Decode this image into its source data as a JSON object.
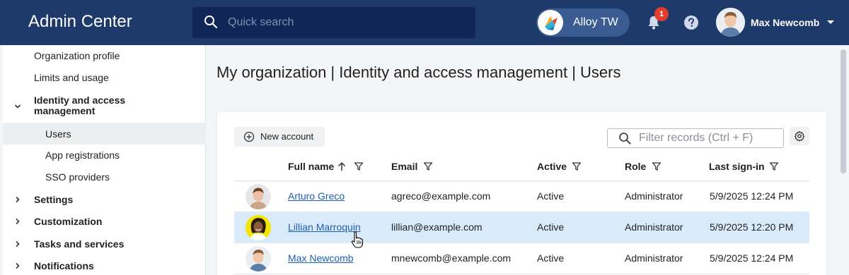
{
  "header": {
    "app_title": "Admin Center",
    "search_placeholder": "Quick search",
    "tenant_name": "Alloy TW",
    "notification_count": "1",
    "user_name": "Max Newcomb",
    "colors": {
      "bar": "#1d3a6b",
      "search": "#0f2656",
      "badge": "#e53b2d"
    }
  },
  "sidebar": {
    "items": [
      {
        "label": "Organization profile"
      },
      {
        "label": "Limits and usage"
      },
      {
        "label": "Identity and access management"
      },
      {
        "label": "Users"
      },
      {
        "label": "App registrations"
      },
      {
        "label": "SSO providers"
      },
      {
        "label": "Settings"
      },
      {
        "label": "Customization"
      },
      {
        "label": "Tasks and services"
      },
      {
        "label": "Notifications"
      }
    ]
  },
  "main": {
    "title": "My organization | Identity and access management | Users",
    "new_account_label": "New account",
    "filter_placeholder": "Filter records (Ctrl + F)",
    "columns": [
      "Full name",
      "Email",
      "Active",
      "Role",
      "Last sign-in"
    ],
    "rows": [
      {
        "name": "Arturo Greco",
        "email": "agreco@example.com",
        "active": "Active",
        "role": "Administrator",
        "last_sign_in": "5/9/2025 12:24 PM"
      },
      {
        "name": "Lillian Marroquin",
        "email": "lillian@example.com",
        "active": "Active",
        "role": "Administrator",
        "last_sign_in": "5/9/2025 12:20 PM"
      },
      {
        "name": "Max Newcomb",
        "email": "mnewcomb@example.com",
        "active": "Active",
        "role": "Administrator",
        "last_sign_in": "5/9/2025 12:24 PM"
      }
    ]
  }
}
